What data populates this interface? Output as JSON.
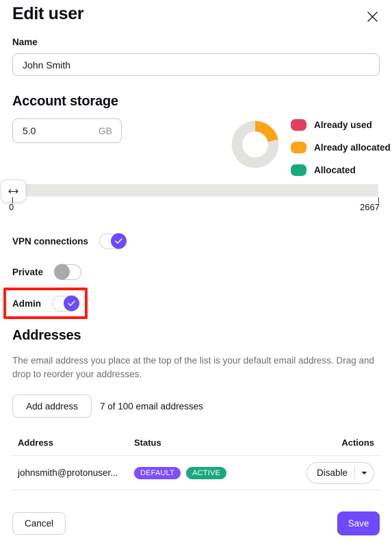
{
  "header": {
    "title": "Edit user",
    "close_icon": "close-icon"
  },
  "name_field": {
    "label": "Name",
    "value": "John Smith",
    "placeholder": "Name"
  },
  "storage": {
    "section_title": "Account storage",
    "value": "5.0",
    "unit": "GB",
    "legend": [
      {
        "label": "Already used",
        "color": "#e0405e"
      },
      {
        "label": "Already allocated",
        "color": "#ffa318"
      },
      {
        "label": "Allocated",
        "color": "#19a97e"
      }
    ],
    "donut": {
      "track_color": "#e4e2de",
      "segment_color": "#ffa318",
      "segment_percent": 21
    },
    "slider": {
      "handle_icon": "resize-horizontal-icon",
      "min_label": "0",
      "max_label": "2667",
      "value": 0,
      "min": 0,
      "max": 2667
    }
  },
  "toggles": [
    {
      "label": "VPN connections",
      "state": "on"
    },
    {
      "label": "Private",
      "state": "off"
    },
    {
      "label": "Admin",
      "state": "on"
    }
  ],
  "addresses": {
    "section_title": "Addresses",
    "description": "The email address you place at the top of the list is your default email address. Drag and drop to reorder your addresses.",
    "add_button": "Add address",
    "count_text": "7 of 100 email addresses",
    "columns": [
      "Address",
      "Status",
      "Actions"
    ],
    "rows": [
      {
        "address": "johnsmith@protonuser...",
        "badges": [
          {
            "label": "DEFAULT",
            "color": "#7d4dff"
          },
          {
            "label": "ACTIVE",
            "color": "#19a97e"
          }
        ],
        "action": {
          "label": "Disable",
          "caret_icon": "chevron-down-icon"
        }
      }
    ]
  },
  "footer": {
    "cancel_label": "Cancel",
    "save_label": "Save",
    "save_color": "#6d4aff"
  },
  "highlight": {
    "color": "#ff1c0f",
    "target": "admin-toggle-row"
  }
}
